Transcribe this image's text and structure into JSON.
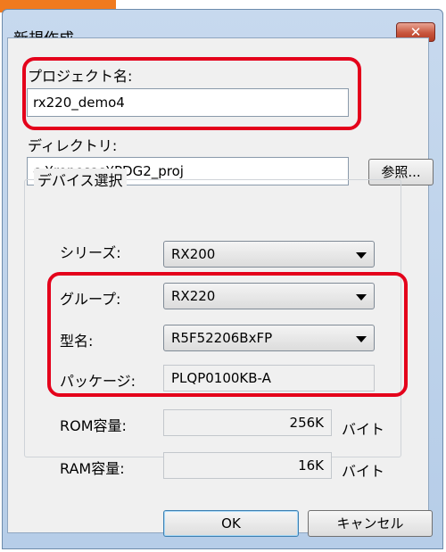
{
  "window": {
    "title": "新規作成",
    "close_glyph": "✕"
  },
  "project": {
    "label": "プロジェクト名:",
    "value": "rx220_demo4"
  },
  "directory": {
    "label": "ディレクトリ:",
    "value": "c:¥renesas¥PDG2_proj",
    "browse_label": "参照..."
  },
  "device": {
    "group_title": "デバイス選択",
    "series_label": "シリーズ:",
    "series_value": "RX200",
    "group_label": "グループ:",
    "group_value": "RX220",
    "model_label": "型名:",
    "model_value": "R5F52206BxFP",
    "package_label": "パッケージ:",
    "package_value": "PLQP0100KB-A",
    "rom_label": "ROM容量:",
    "rom_value": "256K",
    "rom_unit": "バイト",
    "ram_label": "RAM容量:",
    "ram_value": "16K",
    "ram_unit": "バイト"
  },
  "footer": {
    "ok_label": "OK",
    "cancel_label": "キャンセル"
  },
  "colors": {
    "highlight": "#e4001b",
    "accent_strip": "#f07a1e",
    "close_button": "#c8553d"
  }
}
